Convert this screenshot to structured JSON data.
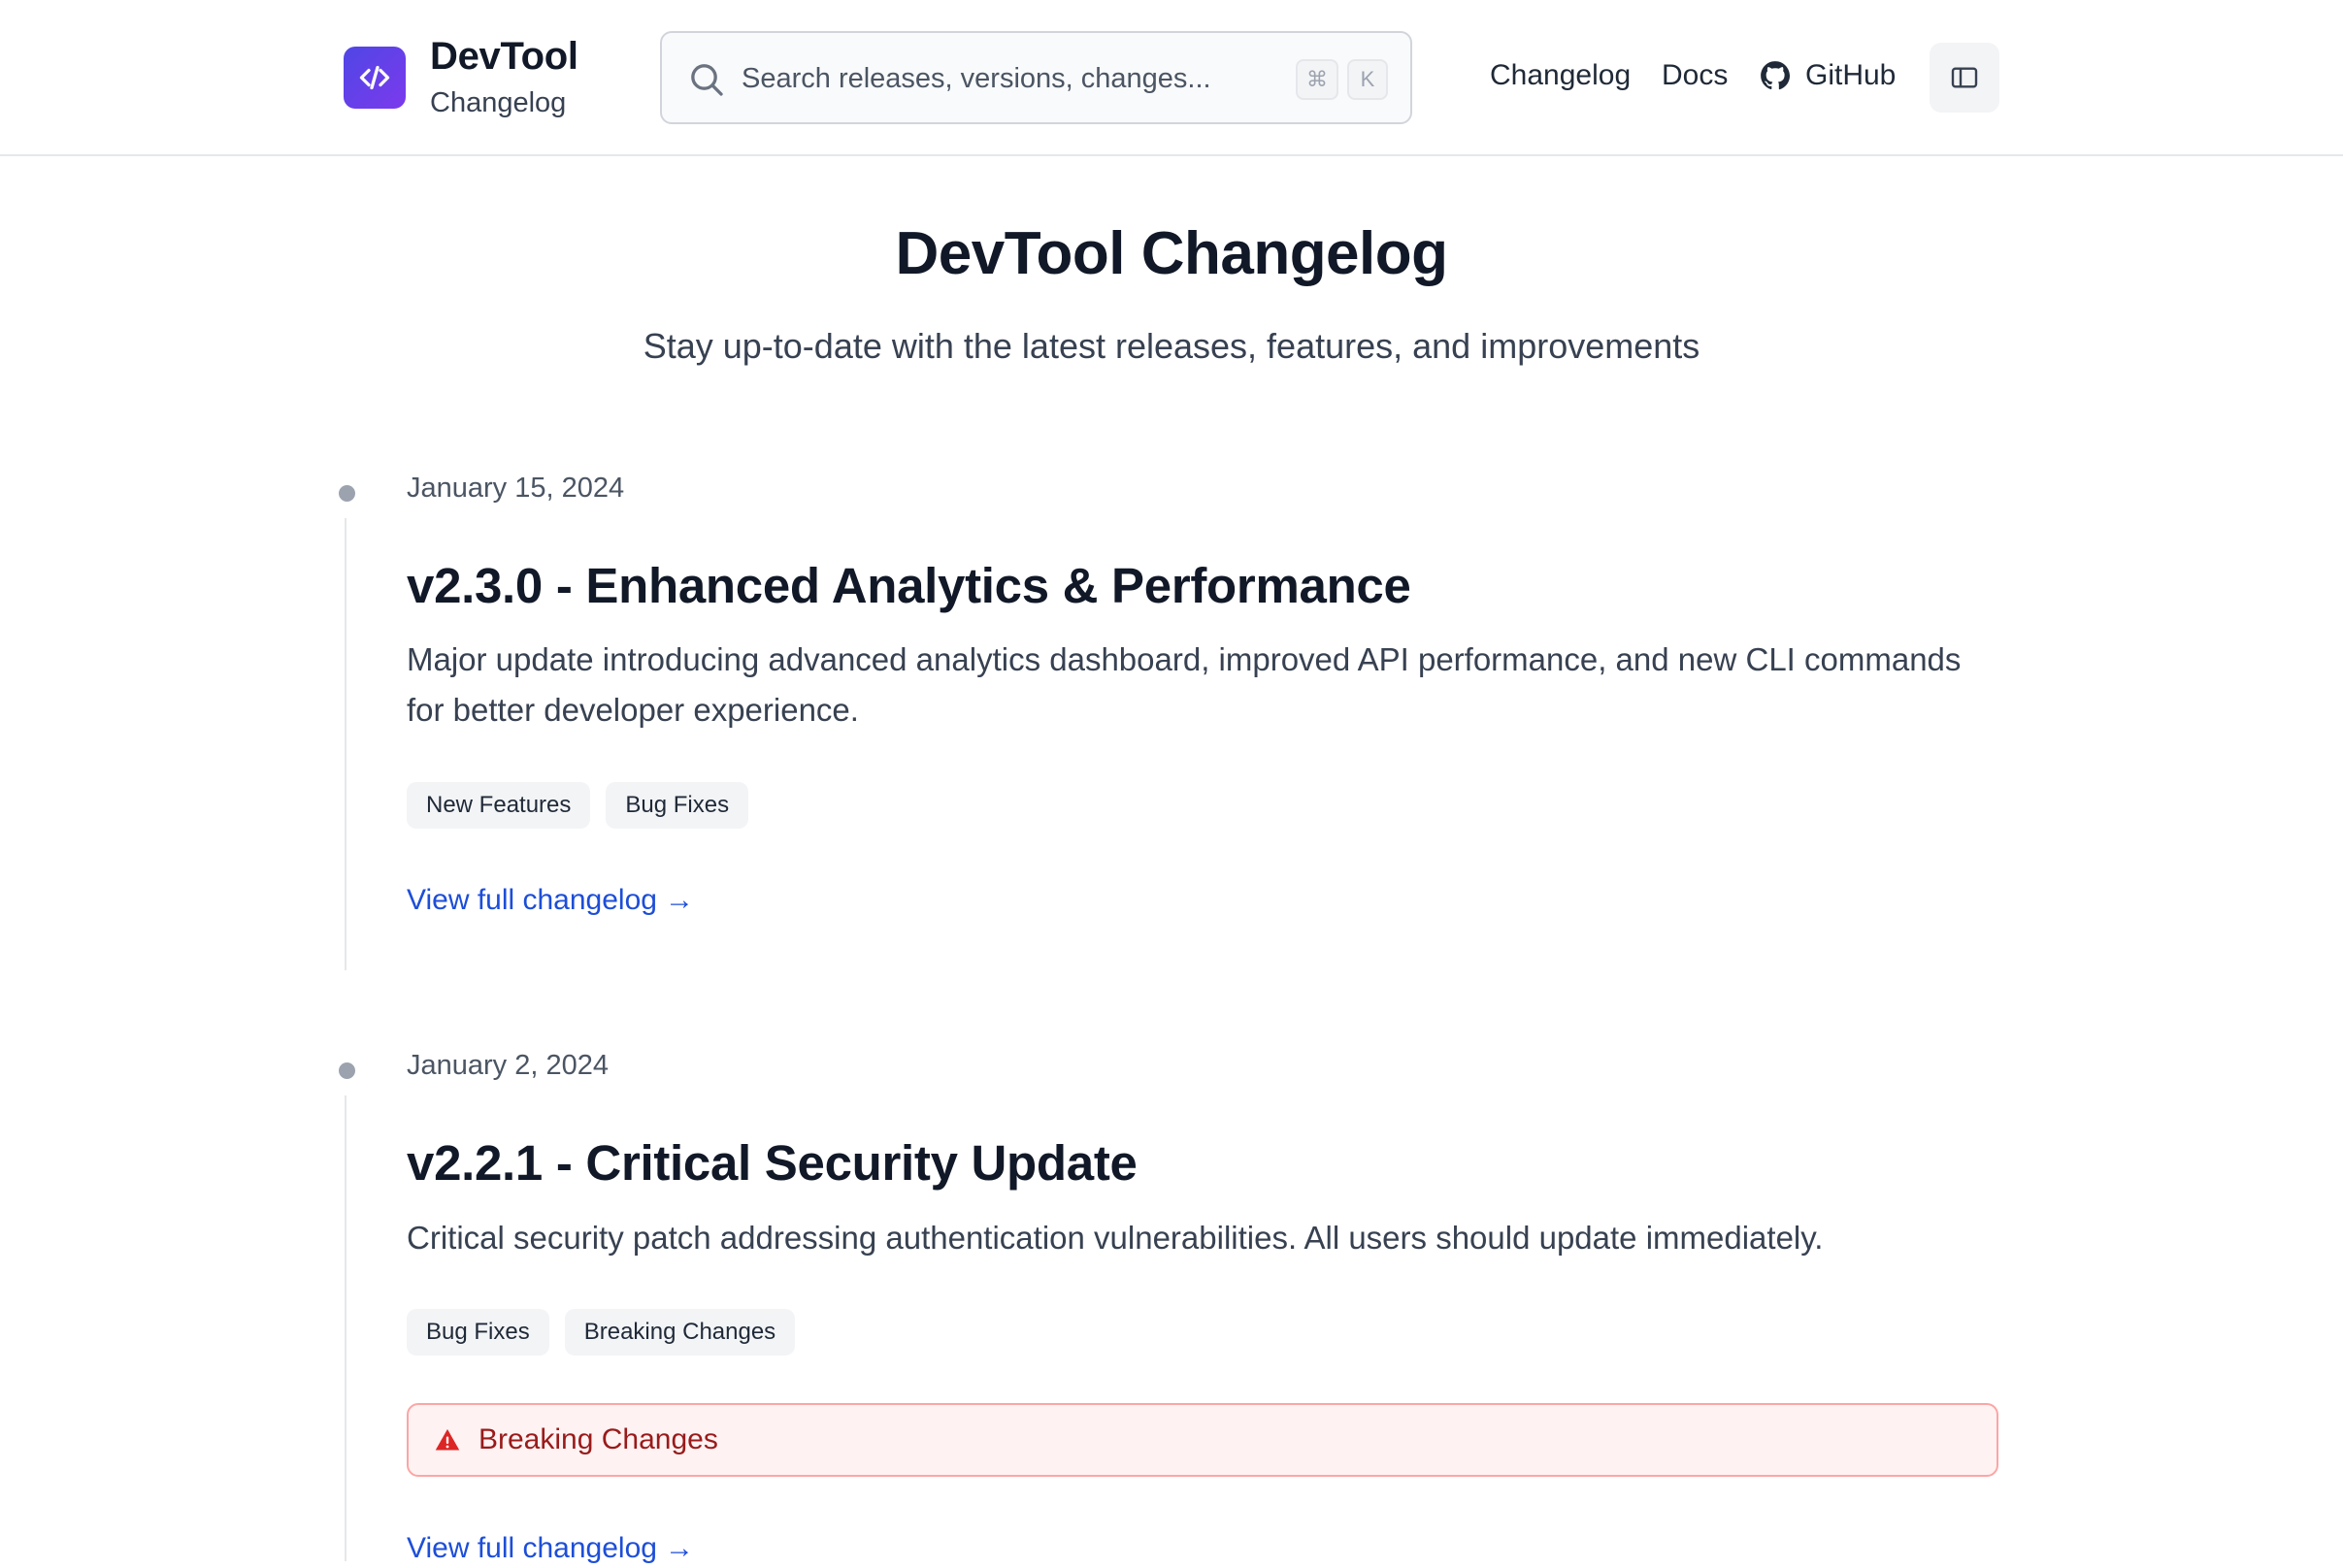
{
  "header": {
    "brand_name": "DevTool",
    "brand_sub": "Changelog",
    "search_placeholder": "Search releases, versions, changes...",
    "shortcut_cmd": "⌘",
    "shortcut_key": "K",
    "nav": {
      "changelog": "Changelog",
      "docs": "Docs",
      "github": "GitHub"
    },
    "icons": [
      "code-icon",
      "search-icon",
      "github-icon",
      "sidebar-panel-icon"
    ]
  },
  "hero": {
    "title": "DevTool Changelog",
    "subtitle": "Stay up-to-date with the latest releases, features, and improvements"
  },
  "releases": [
    {
      "date": "January 15, 2024",
      "title": "v2.3.0 - Enhanced Analytics & Performance",
      "description": "Major update introducing advanced analytics dashboard, improved API performance, and new CLI commands for better developer experience.",
      "tags": [
        "New Features",
        "Bug Fixes"
      ],
      "link_label": "View full changelog",
      "link_arrow": "→"
    },
    {
      "date": "January 2, 2024",
      "title": "v2.2.1 - Critical Security Update",
      "description": "Critical security patch addressing authentication vulnerabilities. All users should update immediately.",
      "tags": [
        "Bug Fixes",
        "Breaking Changes"
      ],
      "alert": "Breaking Changes",
      "alert_icon": "warning-icon",
      "link_label": "View full changelog",
      "link_arrow": "→"
    }
  ],
  "colors": {
    "brand_gradient_start": "#4f46e5",
    "brand_gradient_end": "#7c3aed",
    "link": "#1d4ed8",
    "alert_text": "#991b1b",
    "alert_bg": "#fef2f2",
    "alert_border": "#fca5a5"
  }
}
